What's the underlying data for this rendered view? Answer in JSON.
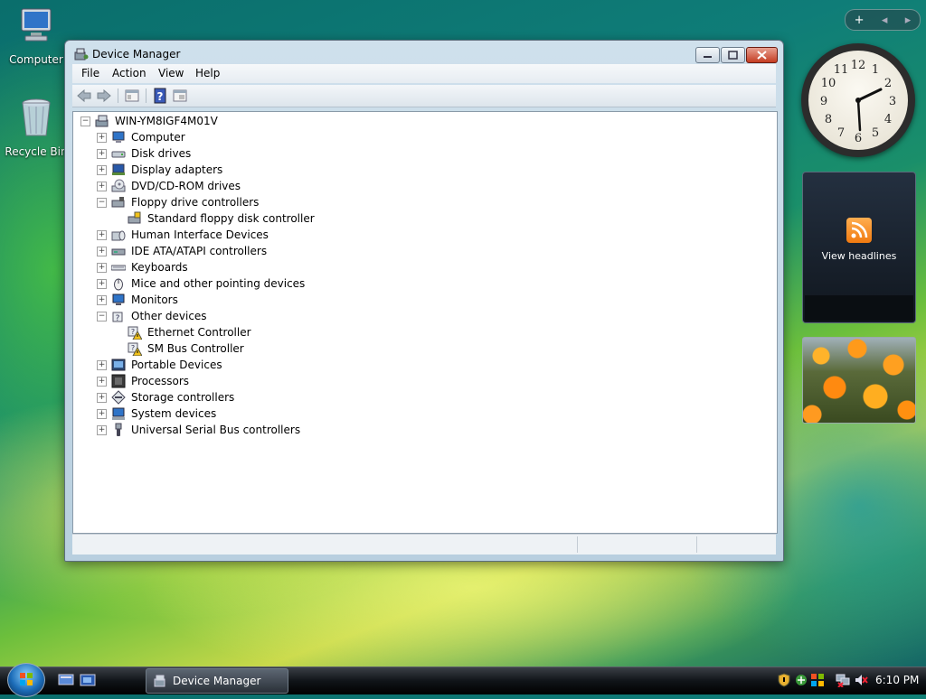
{
  "desktop": {
    "icons": [
      {
        "label": "Computer",
        "icon": "computer-icon"
      },
      {
        "label": "Recycle Bin",
        "icon": "recycle-bin-icon"
      }
    ]
  },
  "sidebar": {
    "controls": [
      "+",
      "◂",
      "▸"
    ],
    "clock": {
      "numbers": [
        "12",
        "1",
        "2",
        "3",
        "4",
        "5",
        "6",
        "7",
        "8",
        "9",
        "10",
        "11"
      ],
      "time_shown": "6:10"
    },
    "feed": {
      "label": "View headlines",
      "icon": "rss-icon",
      "accent": "#f5891e"
    },
    "slideshow": {
      "icon": "flowers-photo"
    }
  },
  "window": {
    "title": "Device Manager",
    "menu": [
      "File",
      "Action",
      "View",
      "Help"
    ],
    "toolbar": [
      "back-icon",
      "forward-icon",
      "properties-icon",
      "help-icon",
      "update-driver-icon"
    ],
    "tree": {
      "root": "WIN-YM8IGF4M01V",
      "items": [
        {
          "label": "Computer",
          "expanded": false,
          "icon": "computer-icon",
          "children": []
        },
        {
          "label": "Disk drives",
          "expanded": false,
          "icon": "disk-drive-icon",
          "children": []
        },
        {
          "label": "Display adapters",
          "expanded": false,
          "icon": "display-adapter-icon",
          "children": []
        },
        {
          "label": "DVD/CD-ROM drives",
          "expanded": false,
          "icon": "dvd-drive-icon",
          "children": []
        },
        {
          "label": "Floppy drive controllers",
          "expanded": true,
          "icon": "floppy-controller-icon",
          "children": [
            {
              "label": "Standard floppy disk controller",
              "icon": "floppy-controller-icon",
              "warning": false
            }
          ]
        },
        {
          "label": "Human Interface Devices",
          "expanded": false,
          "icon": "hid-icon",
          "children": []
        },
        {
          "label": "IDE ATA/ATAPI controllers",
          "expanded": false,
          "icon": "ide-controller-icon",
          "children": []
        },
        {
          "label": "Keyboards",
          "expanded": false,
          "icon": "keyboard-icon",
          "children": []
        },
        {
          "label": "Mice and other pointing devices",
          "expanded": false,
          "icon": "mouse-icon",
          "children": []
        },
        {
          "label": "Monitors",
          "expanded": false,
          "icon": "monitor-icon",
          "children": []
        },
        {
          "label": "Other devices",
          "expanded": true,
          "icon": "unknown-device-icon",
          "children": [
            {
              "label": "Ethernet Controller",
              "icon": "unknown-device-icon",
              "warning": true
            },
            {
              "label": "SM Bus Controller",
              "icon": "unknown-device-icon",
              "warning": true
            }
          ]
        },
        {
          "label": "Portable Devices",
          "expanded": false,
          "icon": "portable-device-icon",
          "children": []
        },
        {
          "label": "Processors",
          "expanded": false,
          "icon": "processor-icon",
          "children": []
        },
        {
          "label": "Storage controllers",
          "expanded": false,
          "icon": "storage-controller-icon",
          "children": []
        },
        {
          "label": "System devices",
          "expanded": false,
          "icon": "system-device-icon",
          "children": []
        },
        {
          "label": "Universal Serial Bus controllers",
          "expanded": false,
          "icon": "usb-icon",
          "children": []
        }
      ]
    }
  },
  "taskbar": {
    "quick_launch": [
      "show-desktop-icon",
      "switch-windows-icon"
    ],
    "tasks": [
      {
        "label": "Device Manager",
        "icon": "device-manager-icon"
      }
    ],
    "tray_icons": [
      "security-shield-icon",
      "network-sharing-icon",
      "windows-update-icon",
      "network-disconnected-icon",
      "volume-muted-icon"
    ],
    "clock": "6:10 PM"
  },
  "colors": {
    "warning": "#f2c21a",
    "close_button": "#c43c22",
    "feed_accent": "#f5891e"
  }
}
